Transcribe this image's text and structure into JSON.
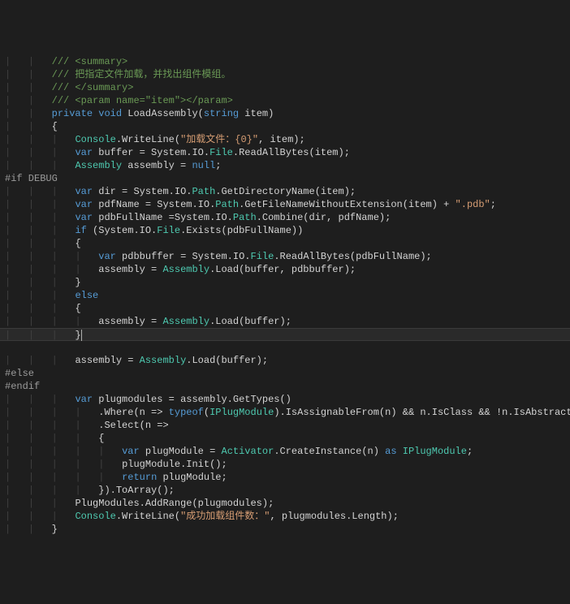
{
  "lines": [
    {
      "indent": 2,
      "segs": [
        {
          "cls": "c-comment",
          "t": "/// <summary>"
        }
      ]
    },
    {
      "indent": 2,
      "segs": [
        {
          "cls": "c-comment",
          "t": "/// 把指定文件加载，并找出组件模组。"
        }
      ]
    },
    {
      "indent": 2,
      "segs": [
        {
          "cls": "c-comment",
          "t": "/// </summary>"
        }
      ]
    },
    {
      "indent": 2,
      "segs": [
        {
          "cls": "c-comment",
          "t": "/// <param name=\"item\"></param>"
        }
      ]
    },
    {
      "indent": 2,
      "segs": [
        {
          "cls": "c-keyword",
          "t": "private"
        },
        {
          "cls": "c-text",
          "t": " "
        },
        {
          "cls": "c-keyword",
          "t": "void"
        },
        {
          "cls": "c-text",
          "t": " LoadAssembly("
        },
        {
          "cls": "c-keyword",
          "t": "string"
        },
        {
          "cls": "c-text",
          "t": " item)"
        }
      ]
    },
    {
      "indent": 2,
      "segs": [
        {
          "cls": "c-text",
          "t": "{"
        }
      ]
    },
    {
      "indent": 3,
      "segs": [
        {
          "cls": "c-type",
          "t": "Console"
        },
        {
          "cls": "c-text",
          "t": ".WriteLine("
        },
        {
          "cls": "c-string",
          "t": "\"加载文件：{0}\""
        },
        {
          "cls": "c-text",
          "t": ", item);"
        }
      ]
    },
    {
      "indent": 3,
      "segs": [
        {
          "cls": "c-keyword",
          "t": "var"
        },
        {
          "cls": "c-text",
          "t": " buffer = System.IO."
        },
        {
          "cls": "c-type",
          "t": "File"
        },
        {
          "cls": "c-text",
          "t": ".ReadAllBytes(item);"
        }
      ]
    },
    {
      "indent": 3,
      "segs": [
        {
          "cls": "c-type",
          "t": "Assembly"
        },
        {
          "cls": "c-text",
          "t": " assembly = "
        },
        {
          "cls": "c-null",
          "t": "null"
        },
        {
          "cls": "c-text",
          "t": ";"
        }
      ]
    },
    {
      "indent": 0,
      "preproc": true,
      "segs": [
        {
          "cls": "c-preproc",
          "t": "#if DEBUG"
        }
      ]
    },
    {
      "indent": 3,
      "segs": [
        {
          "cls": "c-keyword",
          "t": "var"
        },
        {
          "cls": "c-text",
          "t": " dir = System.IO."
        },
        {
          "cls": "c-type",
          "t": "Path"
        },
        {
          "cls": "c-text",
          "t": ".GetDirectoryName(item);"
        }
      ]
    },
    {
      "indent": 3,
      "segs": [
        {
          "cls": "c-keyword",
          "t": "var"
        },
        {
          "cls": "c-text",
          "t": " pdfName = System.IO."
        },
        {
          "cls": "c-type",
          "t": "Path"
        },
        {
          "cls": "c-text",
          "t": ".GetFileNameWithoutExtension(item) + "
        },
        {
          "cls": "c-string",
          "t": "\".pdb\""
        },
        {
          "cls": "c-text",
          "t": ";"
        }
      ]
    },
    {
      "indent": 3,
      "segs": [
        {
          "cls": "c-keyword",
          "t": "var"
        },
        {
          "cls": "c-text",
          "t": " pdbFullName =System.IO."
        },
        {
          "cls": "c-type",
          "t": "Path"
        },
        {
          "cls": "c-text",
          "t": ".Combine(dir, pdfName);"
        }
      ]
    },
    {
      "indent": 3,
      "segs": [
        {
          "cls": "c-keyword",
          "t": "if"
        },
        {
          "cls": "c-text",
          "t": " (System.IO."
        },
        {
          "cls": "c-type",
          "t": "File"
        },
        {
          "cls": "c-text",
          "t": ".Exists(pdbFullName))"
        }
      ]
    },
    {
      "indent": 3,
      "segs": [
        {
          "cls": "c-text",
          "t": "{"
        }
      ]
    },
    {
      "indent": 4,
      "segs": [
        {
          "cls": "c-keyword",
          "t": "var"
        },
        {
          "cls": "c-text",
          "t": " pdbbuffer = System.IO."
        },
        {
          "cls": "c-type",
          "t": "File"
        },
        {
          "cls": "c-text",
          "t": ".ReadAllBytes(pdbFullName);"
        }
      ]
    },
    {
      "indent": 4,
      "segs": [
        {
          "cls": "c-text",
          "t": "assembly = "
        },
        {
          "cls": "c-type",
          "t": "Assembly"
        },
        {
          "cls": "c-text",
          "t": ".Load(buffer, pdbbuffer);"
        }
      ]
    },
    {
      "indent": 3,
      "segs": [
        {
          "cls": "c-text",
          "t": "}"
        }
      ]
    },
    {
      "indent": 3,
      "segs": [
        {
          "cls": "c-keyword",
          "t": "else"
        }
      ]
    },
    {
      "indent": 3,
      "segs": [
        {
          "cls": "c-text",
          "t": "{"
        }
      ]
    },
    {
      "indent": 4,
      "segs": [
        {
          "cls": "c-text",
          "t": "assembly = "
        },
        {
          "cls": "c-type",
          "t": "Assembly"
        },
        {
          "cls": "c-text",
          "t": ".Load(buffer);"
        }
      ]
    },
    {
      "indent": 3,
      "highlight": true,
      "cursor": true,
      "segs": [
        {
          "cls": "c-text",
          "t": "}"
        }
      ]
    },
    {
      "indent": 0,
      "segs": []
    },
    {
      "indent": 3,
      "segs": [
        {
          "cls": "c-text",
          "t": "assembly = "
        },
        {
          "cls": "c-type",
          "t": "Assembly"
        },
        {
          "cls": "c-text",
          "t": ".Load(buffer);"
        }
      ]
    },
    {
      "indent": 0,
      "preproc": true,
      "segs": [
        {
          "cls": "c-preproc",
          "t": "#else"
        }
      ]
    },
    {
      "indent": 0,
      "preproc": true,
      "segs": [
        {
          "cls": "c-preproc",
          "t": "#endif"
        }
      ]
    },
    {
      "indent": 3,
      "segs": [
        {
          "cls": "c-keyword",
          "t": "var"
        },
        {
          "cls": "c-text",
          "t": " plugmodules = assembly.GetTypes()"
        }
      ]
    },
    {
      "indent": 4,
      "segs": [
        {
          "cls": "c-text",
          "t": ".Where(n => "
        },
        {
          "cls": "c-keyword",
          "t": "typeof"
        },
        {
          "cls": "c-text",
          "t": "("
        },
        {
          "cls": "c-type",
          "t": "IPlugModule"
        },
        {
          "cls": "c-text",
          "t": ").IsAssignableFrom(n) && n.IsClass && !n.IsAbstract)"
        }
      ]
    },
    {
      "indent": 4,
      "segs": [
        {
          "cls": "c-text",
          "t": ".Select(n =>"
        }
      ]
    },
    {
      "indent": 4,
      "segs": [
        {
          "cls": "c-text",
          "t": "{"
        }
      ]
    },
    {
      "indent": 5,
      "segs": [
        {
          "cls": "c-keyword",
          "t": "var"
        },
        {
          "cls": "c-text",
          "t": " plugModule = "
        },
        {
          "cls": "c-type",
          "t": "Activator"
        },
        {
          "cls": "c-text",
          "t": ".CreateInstance(n) "
        },
        {
          "cls": "c-keyword",
          "t": "as"
        },
        {
          "cls": "c-text",
          "t": " "
        },
        {
          "cls": "c-type",
          "t": "IPlugModule"
        },
        {
          "cls": "c-text",
          "t": ";"
        }
      ]
    },
    {
      "indent": 5,
      "segs": [
        {
          "cls": "c-text",
          "t": "plugModule.Init();"
        }
      ]
    },
    {
      "indent": 5,
      "segs": [
        {
          "cls": "c-keyword",
          "t": "return"
        },
        {
          "cls": "c-text",
          "t": " plugModule;"
        }
      ]
    },
    {
      "indent": 4,
      "segs": [
        {
          "cls": "c-text",
          "t": "}).ToArray();"
        }
      ]
    },
    {
      "indent": 3,
      "segs": [
        {
          "cls": "c-text",
          "t": "PlugModules.AddRange(plugmodules);"
        }
      ]
    },
    {
      "indent": 3,
      "segs": [
        {
          "cls": "c-type",
          "t": "Console"
        },
        {
          "cls": "c-text",
          "t": ".WriteLine("
        },
        {
          "cls": "c-string",
          "t": "\"成功加载组件数：\""
        },
        {
          "cls": "c-text",
          "t": ", plugmodules.Length);"
        }
      ]
    },
    {
      "indent": 2,
      "segs": [
        {
          "cls": "c-text",
          "t": "}"
        }
      ]
    }
  ]
}
